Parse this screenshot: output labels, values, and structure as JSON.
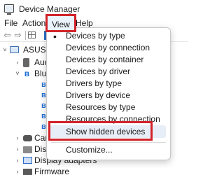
{
  "window": {
    "title": "Device Manager",
    "icon": "device-manager-icon"
  },
  "menubar": {
    "file": "File",
    "action": "Action",
    "view": "View",
    "help": "Help"
  },
  "toolbar": {
    "back_icon": "back-arrow-icon",
    "forward_icon": "forward-arrow-icon",
    "back": "⇦",
    "forward": "⇨"
  },
  "tree": {
    "root": {
      "label": "ASUS",
      "chevron": "˅"
    },
    "audio": {
      "label": "Aud",
      "chevron": "›"
    },
    "bluetooth": {
      "label": "Blue",
      "chevron": "˅"
    },
    "bt_children": [
      "ʙ",
      "ʙ",
      "ʙ",
      "ʙ",
      "ʙ"
    ],
    "cameras": {
      "label": "Cam",
      "chevron": "›"
    },
    "disk": {
      "label": "Disk",
      "chevron": "›"
    },
    "display": {
      "label": "Display adapters",
      "chevron": "›"
    },
    "firmware": {
      "label": "Firmware",
      "chevron": "›"
    }
  },
  "view_menu": {
    "items": [
      {
        "label": "Devices by type",
        "checked": true
      },
      {
        "label": "Devices by connection"
      },
      {
        "label": "Devices by container"
      },
      {
        "label": "Devices by driver"
      },
      {
        "label": "Drivers by type"
      },
      {
        "label": "Drivers by device"
      },
      {
        "label": "Resources by type"
      },
      {
        "label": "Resources by connection"
      }
    ],
    "bullet": "•",
    "show_hidden": "Show hidden devices",
    "customize": "Customize..."
  },
  "colors": {
    "highlight_box": "#d2232a",
    "accent": "#1f6fd6"
  }
}
